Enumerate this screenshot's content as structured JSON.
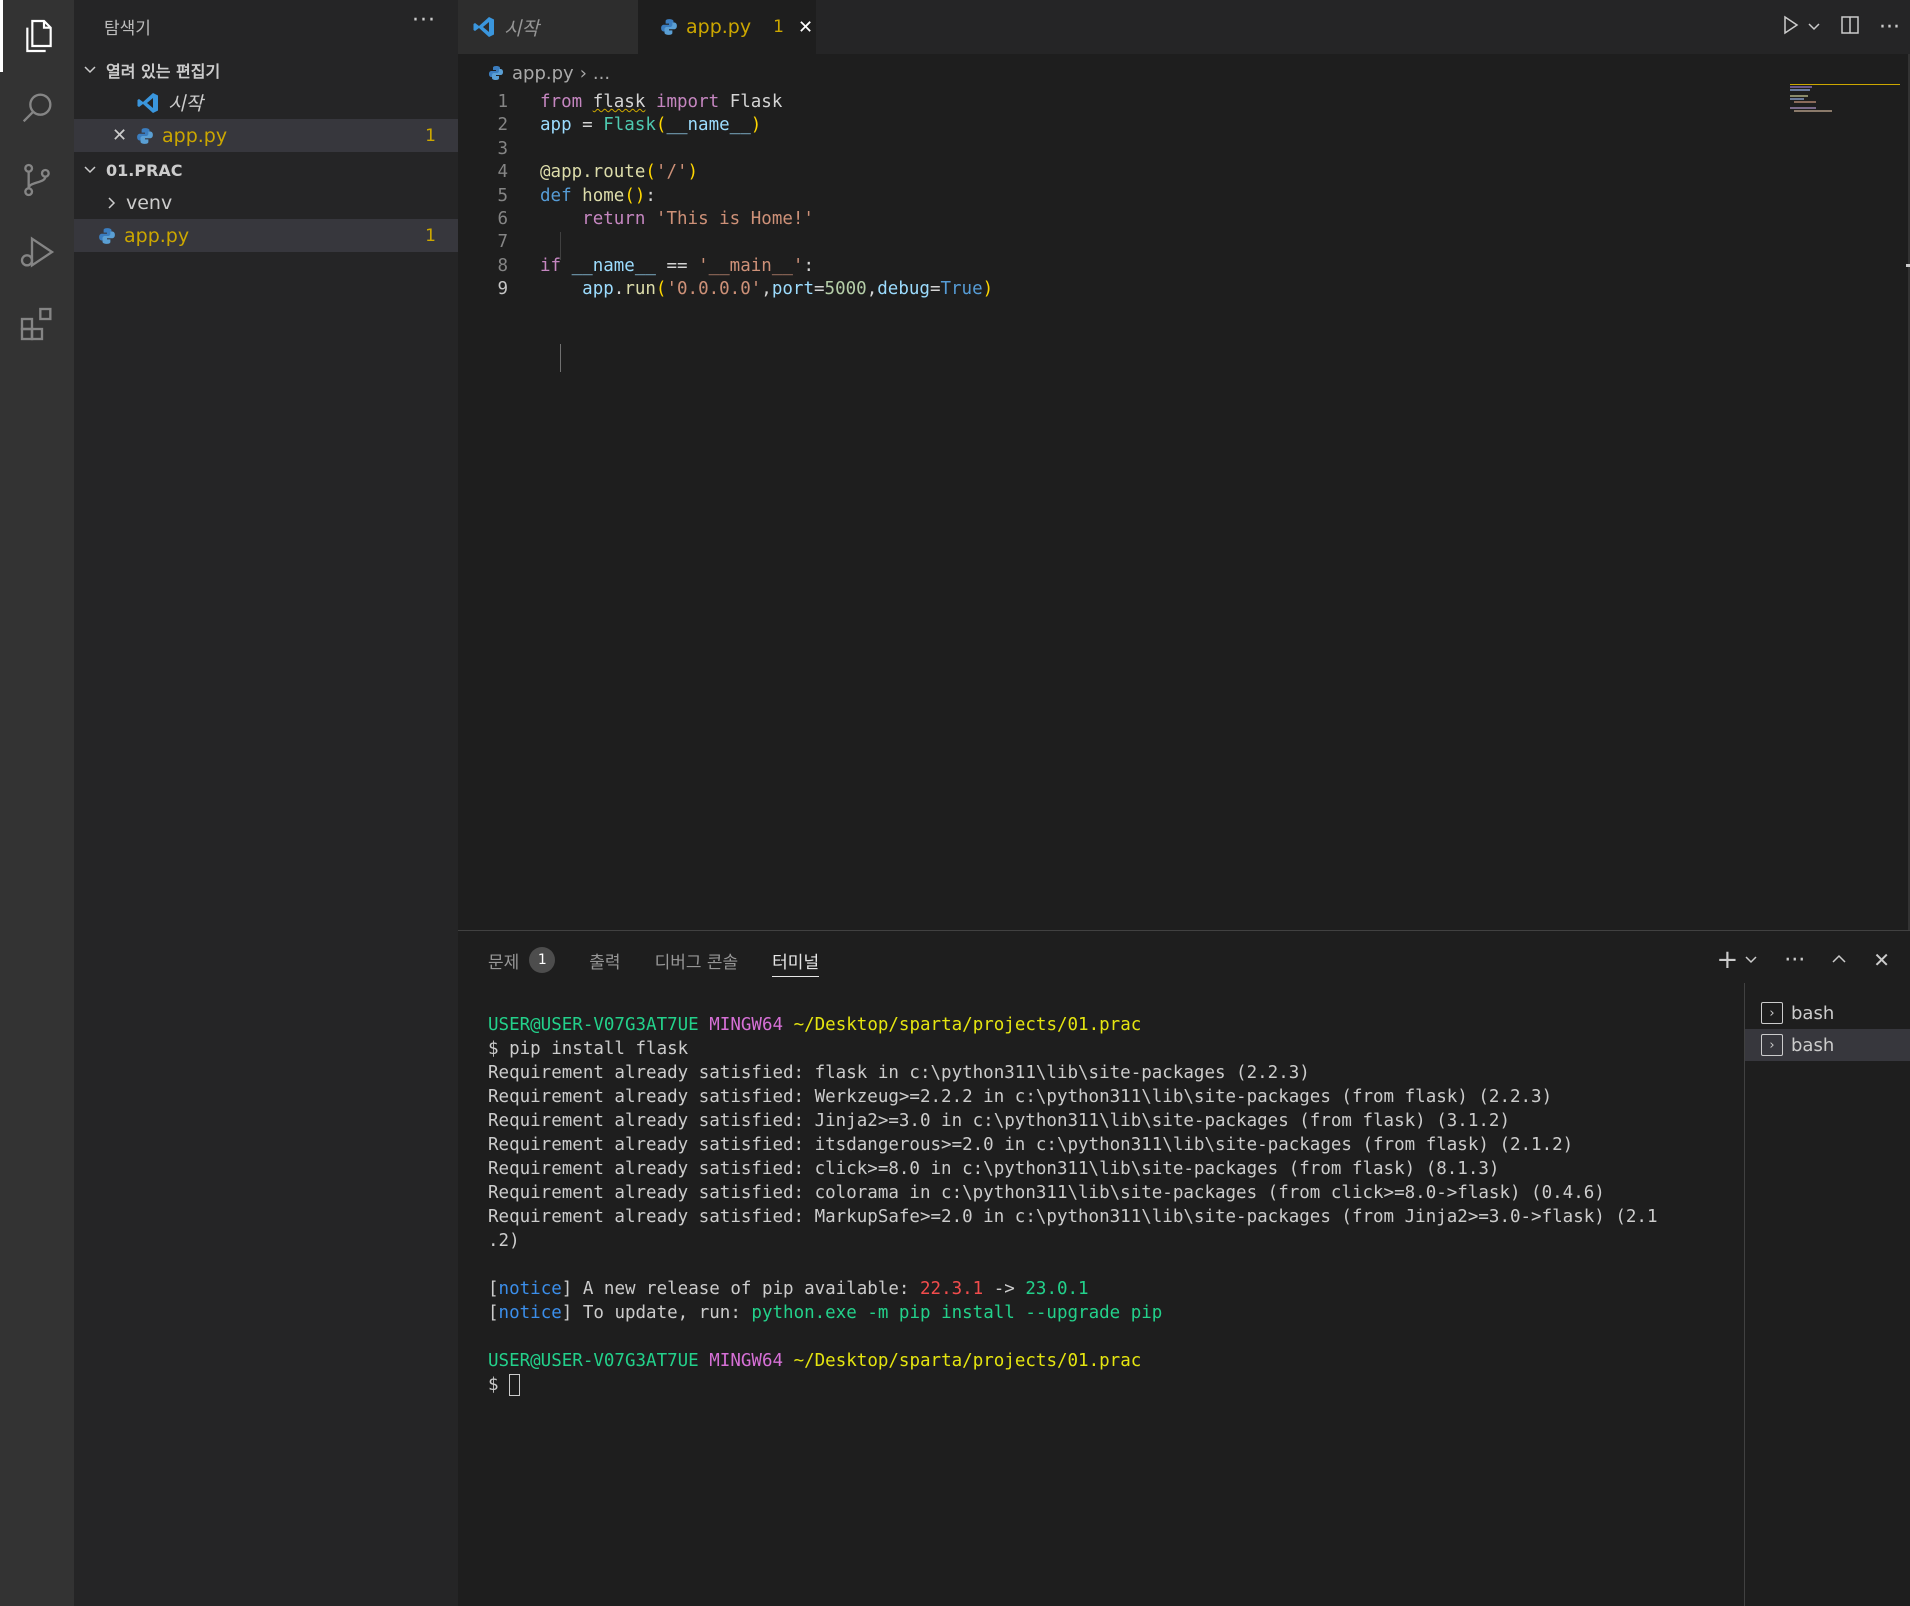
{
  "sidebar": {
    "title": "탐색기",
    "more": "···",
    "open_editors": {
      "header": "열려 있는 편집기",
      "items": [
        {
          "name": "시작"
        },
        {
          "name": "app.py",
          "badge": "1"
        }
      ]
    },
    "folder": {
      "header": "01.PRAC",
      "items": [
        {
          "name": "venv"
        },
        {
          "name": "app.py",
          "badge": "1"
        }
      ]
    }
  },
  "tabs": [
    {
      "label": "시작"
    },
    {
      "label": "app.py",
      "badge": "1",
      "close": "✕"
    }
  ],
  "breadcrumb": {
    "file": "app.py",
    "sep": "›",
    "rest": "..."
  },
  "editor": {
    "line_numbers": [
      "1",
      "2",
      "3",
      "4",
      "5",
      "6",
      "7",
      "8",
      "9"
    ],
    "current_line": "9",
    "lines": [
      [
        {
          "t": "from",
          "c": "kw"
        },
        {
          "t": " "
        },
        {
          "t": "flask",
          "c": "squig"
        },
        {
          "t": " "
        },
        {
          "t": "import",
          "c": "kw"
        },
        {
          "t": " Flask"
        }
      ],
      [
        {
          "t": "app",
          "c": "va"
        },
        {
          "t": " = "
        },
        {
          "t": "Flask",
          "c": "cl"
        },
        {
          "t": "(",
          "c": "br"
        },
        {
          "t": "__name__",
          "c": "va"
        },
        {
          "t": ")",
          "c": "br"
        }
      ],
      [],
      [
        {
          "t": "@app.route",
          "c": "fn"
        },
        {
          "t": "(",
          "c": "br"
        },
        {
          "t": "'/'",
          "c": "st"
        },
        {
          "t": ")",
          "c": "br"
        }
      ],
      [
        {
          "t": "def",
          "c": "kd"
        },
        {
          "t": " "
        },
        {
          "t": "home",
          "c": "fn"
        },
        {
          "t": "()",
          "c": "br"
        },
        {
          "t": ":"
        }
      ],
      [
        {
          "t": "    "
        },
        {
          "t": "return",
          "c": "kw"
        },
        {
          "t": " "
        },
        {
          "t": "'This is Home!'",
          "c": "st"
        }
      ],
      [],
      [
        {
          "t": "if",
          "c": "kw"
        },
        {
          "t": " "
        },
        {
          "t": "__name__",
          "c": "va"
        },
        {
          "t": " == "
        },
        {
          "t": "'__main__'",
          "c": "st"
        },
        {
          "t": ":"
        }
      ],
      [
        {
          "t": "    "
        },
        {
          "t": "app",
          "c": "va"
        },
        {
          "t": "."
        },
        {
          "t": "run",
          "c": "fn"
        },
        {
          "t": "(",
          "c": "br"
        },
        {
          "t": "'0.0.0.0'",
          "c": "st"
        },
        {
          "t": ","
        },
        {
          "t": "port",
          "c": "va"
        },
        {
          "t": "="
        },
        {
          "t": "5000",
          "c": "nu"
        },
        {
          "t": ","
        },
        {
          "t": "debug",
          "c": "va"
        },
        {
          "t": "="
        },
        {
          "t": "True",
          "c": "kd"
        },
        {
          "t": ")",
          "c": "br"
        }
      ]
    ]
  },
  "panel": {
    "tabs": [
      {
        "label": "문제",
        "badge": "1"
      },
      {
        "label": "출력"
      },
      {
        "label": "디버그 콘솔"
      },
      {
        "label": "터미널"
      }
    ],
    "active_tab": "터미널",
    "terminal_lines": [
      [
        {
          "t": "USER@USER-V07G3AT7UE",
          "c": "tg"
        },
        {
          "t": " "
        },
        {
          "t": "MINGW64",
          "c": "tm"
        },
        {
          "t": " "
        },
        {
          "t": "~/Desktop/sparta/projects/01.prac",
          "c": "ty"
        }
      ],
      [
        {
          "t": "$ pip install flask"
        }
      ],
      [
        {
          "t": "Requirement already satisfied: flask in c:\\python311\\lib\\site-packages (2.2.3)"
        }
      ],
      [
        {
          "t": "Requirement already satisfied: Werkzeug>=2.2.2 in c:\\python311\\lib\\site-packages (from flask) (2.2.3)"
        }
      ],
      [
        {
          "t": "Requirement already satisfied: Jinja2>=3.0 in c:\\python311\\lib\\site-packages (from flask) (3.1.2)"
        }
      ],
      [
        {
          "t": "Requirement already satisfied: itsdangerous>=2.0 in c:\\python311\\lib\\site-packages (from flask) (2.1.2)"
        }
      ],
      [
        {
          "t": "Requirement already satisfied: click>=8.0 in c:\\python311\\lib\\site-packages (from flask) (8.1.3)"
        }
      ],
      [
        {
          "t": "Requirement already satisfied: colorama in c:\\python311\\lib\\site-packages (from click>=8.0->flask) (0.4.6)"
        }
      ],
      [
        {
          "t": "Requirement already satisfied: MarkupSafe>=2.0 in c:\\python311\\lib\\site-packages (from Jinja2>=3.0->flask) (2.1"
        }
      ],
      [
        {
          "t": ".2)"
        }
      ],
      [],
      [
        {
          "t": "["
        },
        {
          "t": "notice",
          "c": "tb"
        },
        {
          "t": "] A new release of pip available: "
        },
        {
          "t": "22.3.1",
          "c": "tr"
        },
        {
          "t": " -> "
        },
        {
          "t": "23.0.1",
          "c": "tg"
        }
      ],
      [
        {
          "t": "["
        },
        {
          "t": "notice",
          "c": "tb"
        },
        {
          "t": "] To update, run: "
        },
        {
          "t": "python.exe -m pip install --upgrade pip",
          "c": "tg"
        }
      ],
      [],
      [
        {
          "t": "USER@USER-V07G3AT7UE",
          "c": "tg"
        },
        {
          "t": " "
        },
        {
          "t": "MINGW64",
          "c": "tm"
        },
        {
          "t": " "
        },
        {
          "t": "~/Desktop/sparta/projects/01.prac",
          "c": "ty"
        }
      ],
      [
        {
          "t": "$ "
        }
      ]
    ],
    "terminals": [
      {
        "label": "bash"
      },
      {
        "label": "bash"
      }
    ]
  }
}
